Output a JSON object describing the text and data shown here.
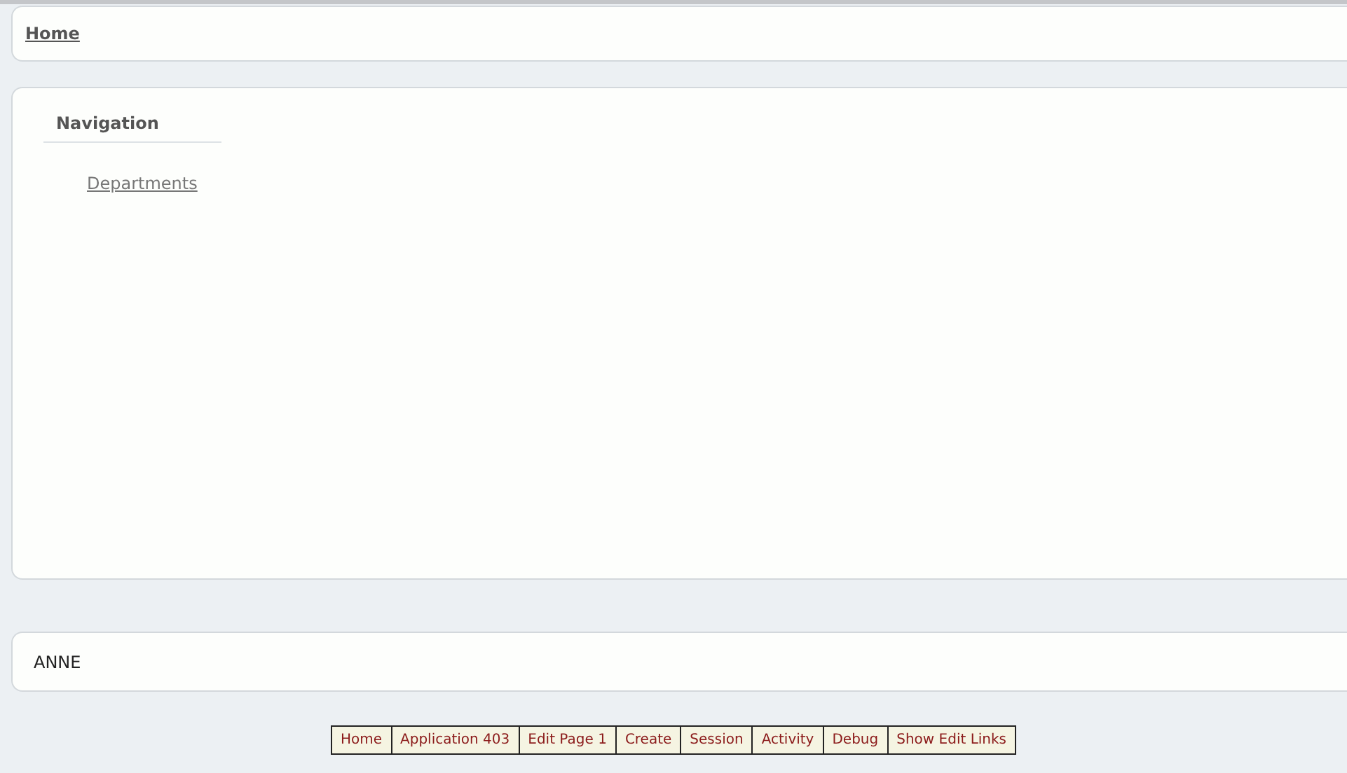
{
  "breadcrumb": {
    "label": "Home"
  },
  "navigation": {
    "title": "Navigation",
    "items": [
      {
        "label": "Departments"
      }
    ]
  },
  "footer": {
    "user": "ANNE"
  },
  "developer_toolbar": [
    {
      "label": "Home"
    },
    {
      "label": "Application 403"
    },
    {
      "label": "Edit Page 1"
    },
    {
      "label": "Create"
    },
    {
      "label": "Session"
    },
    {
      "label": "Activity"
    },
    {
      "label": "Debug"
    },
    {
      "label": "Show Edit Links"
    }
  ]
}
